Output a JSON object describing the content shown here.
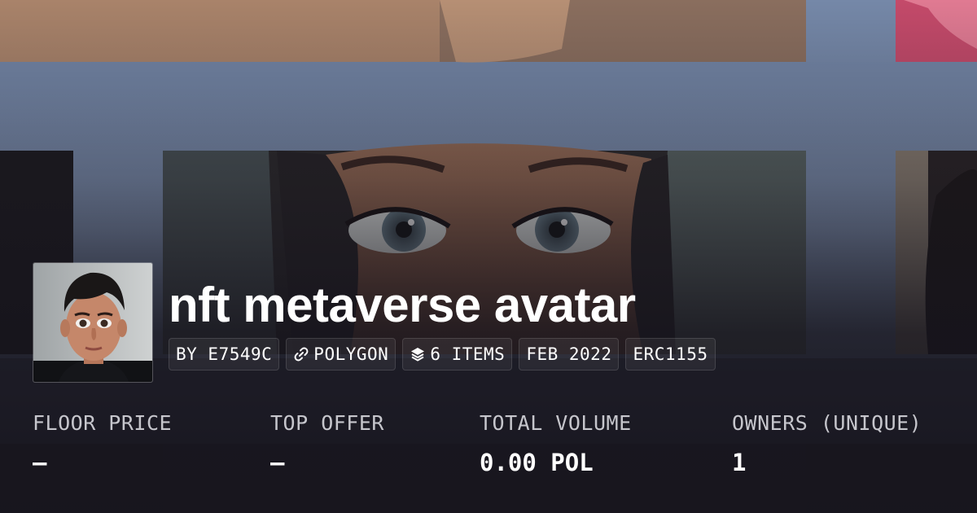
{
  "collection": {
    "name": "nft metaverse avatar",
    "avatar_alt": "collection avatar"
  },
  "meta": {
    "creator": "BY E7549C",
    "chain": "POLYGON",
    "items": "6 ITEMS",
    "date": "FEB 2022",
    "standard": "ERC1155"
  },
  "stats": {
    "floor_price": {
      "label": "FLOOR PRICE",
      "value": "–"
    },
    "top_offer": {
      "label": "TOP OFFER",
      "value": "–"
    },
    "total_volume": {
      "label": "TOTAL VOLUME",
      "value": "0.00 POL"
    },
    "owners": {
      "label": "OWNERS (UNIQUE)",
      "value": "1"
    }
  },
  "icons": {
    "chain": "link-icon",
    "items": "layers-icon"
  },
  "colors": {
    "text": "#ffffff",
    "label": "#c6c6cc",
    "banner_blue": "#6b7fa0",
    "overlay_dark": "#1a1820"
  }
}
